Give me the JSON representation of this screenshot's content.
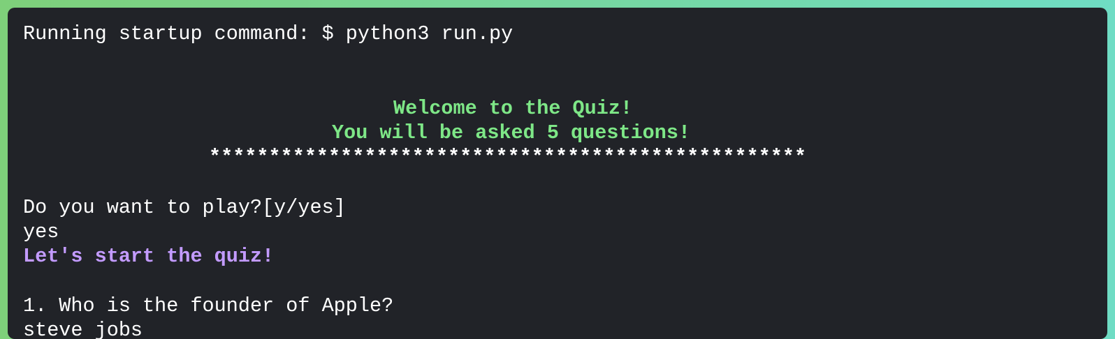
{
  "terminal": {
    "lines": {
      "startup": "Running startup command: $ python3 run.py",
      "welcome": "Welcome to the Quiz!",
      "asked": "You will be asked 5 questions!",
      "stars": "**************************************************",
      "prompt": "Do you want to play?[y/yes]",
      "answer": "yes",
      "start": "Let's start the quiz!",
      "question1": "1. Who is the founder of Apple?",
      "cutoff": "steve jobs"
    },
    "colors": {
      "background": "#212328",
      "text": "#ffffff",
      "green": "#7ee787",
      "purple": "#c39bff"
    }
  }
}
